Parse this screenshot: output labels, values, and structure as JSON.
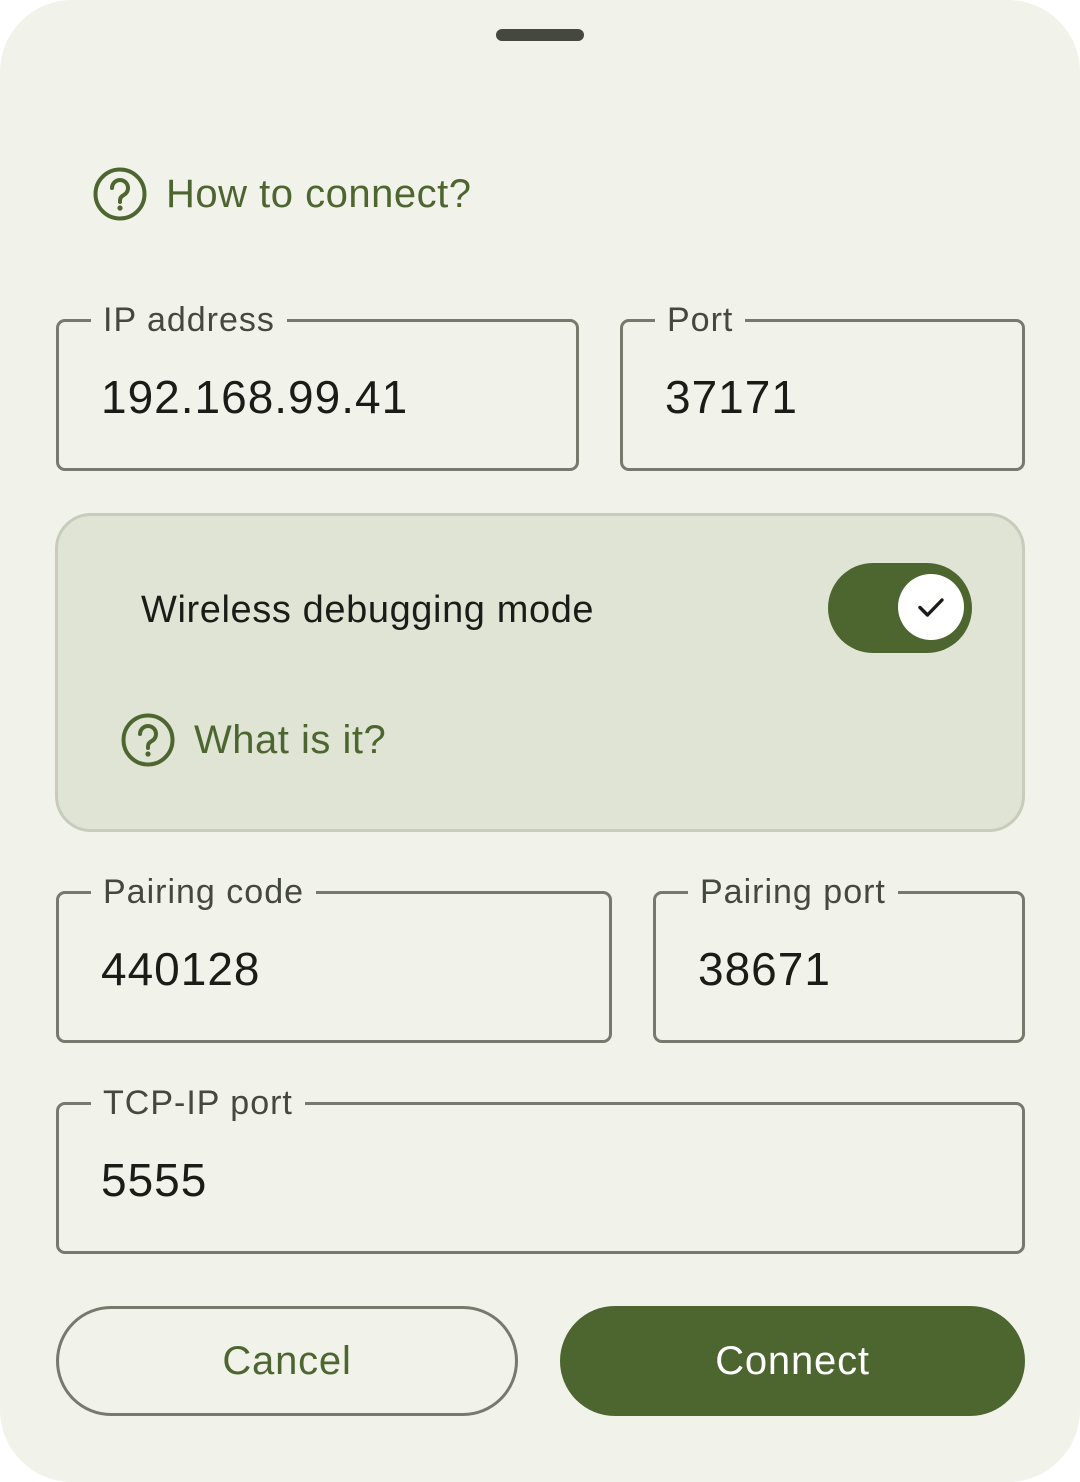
{
  "sheet": {
    "how_to_connect": "How to connect?"
  },
  "fields": {
    "ip": {
      "label": "IP address",
      "value": "192.168.99.41"
    },
    "port": {
      "label": "Port",
      "value": "37171"
    },
    "pairing_code": {
      "label": "Pairing code",
      "value": "440128"
    },
    "pairing_port": {
      "label": "Pairing port",
      "value": "38671"
    },
    "tcpip_port": {
      "label": "TCP-IP port",
      "value": "5555"
    }
  },
  "wireless": {
    "label": "Wireless debugging mode",
    "enabled": true,
    "what_is_it": "What is it?"
  },
  "buttons": {
    "cancel": "Cancel",
    "connect": "Connect"
  },
  "icons": {
    "help": "help-circle-icon",
    "check": "check-icon"
  },
  "colors": {
    "accent": "#4d6630",
    "background": "#f1f2ea",
    "card": "#e0e4d5",
    "outline": "#77796d"
  }
}
